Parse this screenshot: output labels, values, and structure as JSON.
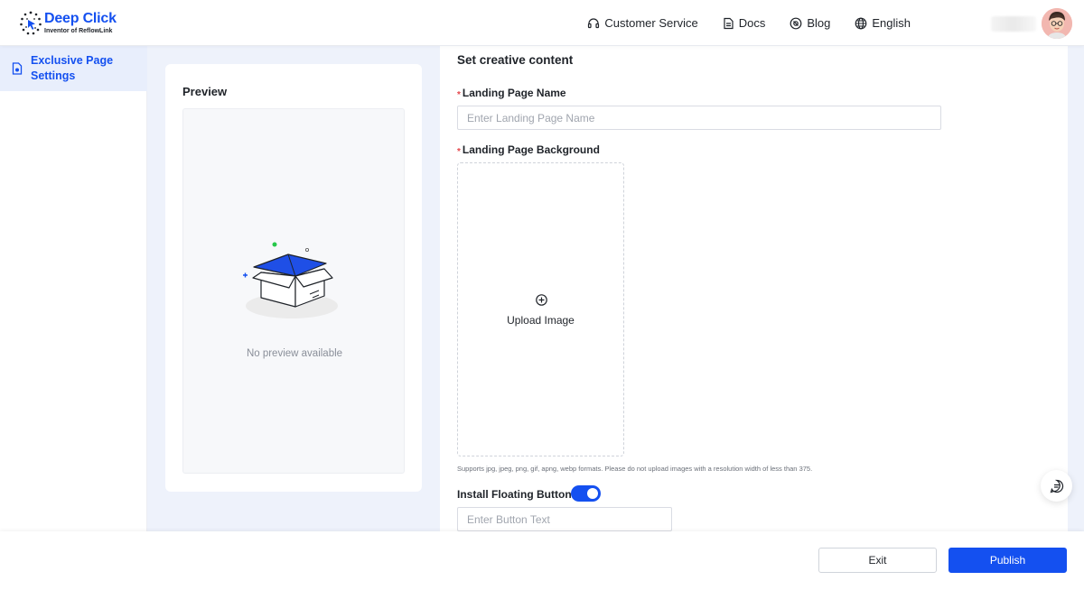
{
  "header": {
    "logo": {
      "title": "Deep Click",
      "subtitle": "Inventor of ReflowLink"
    },
    "nav": [
      {
        "label": "Customer Service",
        "icon": "headset-icon"
      },
      {
        "label": "Docs",
        "icon": "document-icon"
      },
      {
        "label": "Blog",
        "icon": "blog-icon"
      },
      {
        "label": "English",
        "icon": "globe-icon"
      }
    ],
    "user": {
      "avatar": "avatar-icon"
    }
  },
  "sidebar": {
    "items": [
      {
        "label": "Exclusive Page Settings",
        "icon": "page-settings-icon",
        "active": true
      }
    ]
  },
  "preview": {
    "title": "Preview",
    "empty_text": "No preview available"
  },
  "form": {
    "section_title": "Set creative content",
    "landing_name": {
      "required": "*",
      "label": "Landing Page Name",
      "placeholder": "Enter Landing Page Name",
      "value": ""
    },
    "landing_background": {
      "required": "*",
      "label": "Landing Page Background",
      "upload_label": "Upload Image",
      "hint": "Supports jpg, jpeg, png, gif, apng, webp formats. Please do not upload images with a resolution width of less than 375."
    },
    "floating_button": {
      "label": "Install Floating Button",
      "enabled": true,
      "placeholder": "Enter Button Text",
      "value": ""
    }
  },
  "footer": {
    "exit_label": "Exit",
    "publish_label": "Publish"
  },
  "colors": {
    "accent": "#1450f0",
    "required": "#e5484d",
    "background": "#eef2fb"
  }
}
